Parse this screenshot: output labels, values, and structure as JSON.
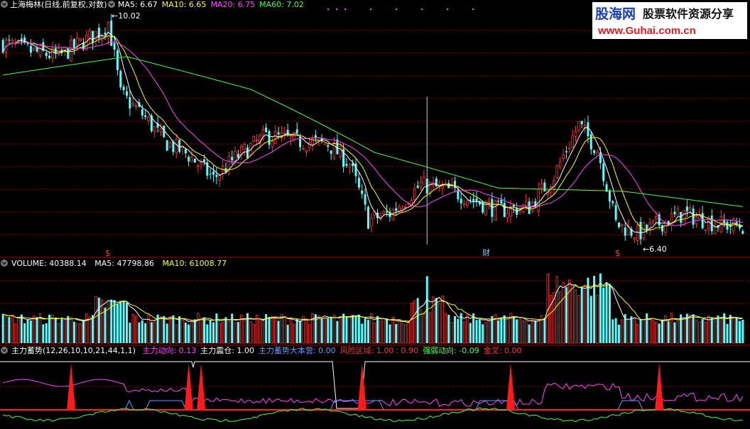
{
  "header": {
    "stock_label": "上海梅林(日线,前复权,对数)",
    "ma_readouts": [
      {
        "text": "MA5: 6.67",
        "color": "#ffffff"
      },
      {
        "text": "MA10: 6.65",
        "color": "#ffff00"
      },
      {
        "text": "MA20: 6.75",
        "color": "#ff44ff"
      },
      {
        "text": "MA60: 7.02",
        "color": "#44ff44"
      }
    ],
    "high_label": "10.02",
    "low_label": "6.40",
    "markers": [
      "$",
      "财",
      "$"
    ]
  },
  "volume_header": {
    "label": "VOLUME: 40388.14",
    "ma5": "MA5: 47798.86",
    "ma10": "MA10: 61008.77"
  },
  "indicator_header": {
    "name": "主力蓄势(12,26,10,10,21,44,1,1)",
    "items": [
      {
        "text": "主力动向: 0.13",
        "color": "#ff44ff"
      },
      {
        "text": "主力震仓: 1.00",
        "color": "#ffffff"
      },
      {
        "text": "主力蓄势大本营: 0.00",
        "color": "#6699ff"
      },
      {
        "text": "风险区域: 1.00",
        "color": "#ff3333"
      },
      {
        "text": ": 0.90",
        "color": "#ff3333"
      },
      {
        "text": "强弱动向: -0.09",
        "color": "#44ff44"
      },
      {
        "text": "金叉: 0.00",
        "color": "#ff3333"
      }
    ]
  },
  "watermark": {
    "brand": "股海网",
    "tagline": "股票软件资源分享",
    "url": "www.Guhai.com.cn"
  },
  "colors": {
    "up": "#ff3333",
    "down": "#54ffff",
    "ma5": "#ffffff",
    "ma10": "#ffff00",
    "ma20": "#ff44ff",
    "ma60": "#44ff44",
    "grid": "#7a0000"
  },
  "chart_data": [
    {
      "type": "candlestick",
      "series": [
        {
          "name": "MA5",
          "values": []
        },
        {
          "name": "MA10",
          "values": []
        },
        {
          "name": "MA20",
          "values": []
        },
        {
          "name": "MA60",
          "values": []
        }
      ],
      "anchor_closes": [
        [
          0,
          9.4
        ],
        [
          10,
          9.2
        ],
        [
          18,
          9.1
        ],
        [
          25,
          9.4
        ],
        [
          32,
          9.7
        ],
        [
          34,
          9.9
        ],
        [
          38,
          8.3
        ],
        [
          45,
          7.9
        ],
        [
          52,
          7.4
        ],
        [
          60,
          7.15
        ],
        [
          68,
          6.75
        ],
        [
          75,
          7.1
        ],
        [
          85,
          7.5
        ],
        [
          95,
          7.4
        ],
        [
          105,
          7.35
        ],
        [
          112,
          7.0
        ],
        [
          118,
          6.1
        ],
        [
          125,
          6.2
        ],
        [
          135,
          6.65
        ],
        [
          145,
          6.55
        ],
        [
          155,
          6.35
        ],
        [
          160,
          6.25
        ],
        [
          170,
          6.3
        ],
        [
          178,
          6.8
        ],
        [
          186,
          7.7
        ],
        [
          192,
          7.25
        ],
        [
          198,
          6.05
        ],
        [
          205,
          5.9
        ],
        [
          212,
          6.05
        ],
        [
          220,
          6.2
        ],
        [
          230,
          6.05
        ],
        [
          240,
          6.0
        ]
      ],
      "ma60_anchors": [
        [
          0,
          8.7
        ],
        [
          40,
          9.1
        ],
        [
          80,
          8.4
        ],
        [
          120,
          7.2
        ],
        [
          160,
          6.6
        ],
        [
          200,
          6.55
        ],
        [
          240,
          6.3
        ]
      ],
      "ylim": [
        5.6,
        10.2
      ],
      "log_scale": true,
      "bars": 240,
      "price_high": 10.02,
      "price_low": 6.4
    },
    {
      "type": "bar",
      "title": "VOLUME",
      "values": {
        "VOLUME": 40388.14,
        "MA5": 47798.86,
        "MA10": 61008.77
      },
      "ylim": [
        0,
        220000
      ]
    },
    {
      "type": "line",
      "title": "主力蓄势",
      "values": {
        "主力动向": 0.13,
        "主力震仓": 1.0,
        "主力蓄势大本营": 0.0,
        "风险区域": 1.0,
        "风险区域2": 0.9,
        "强弱动向": -0.09,
        "金叉": 0.0
      },
      "spike_bars": [
        22,
        60,
        64,
        116,
        164,
        212
      ]
    }
  ]
}
